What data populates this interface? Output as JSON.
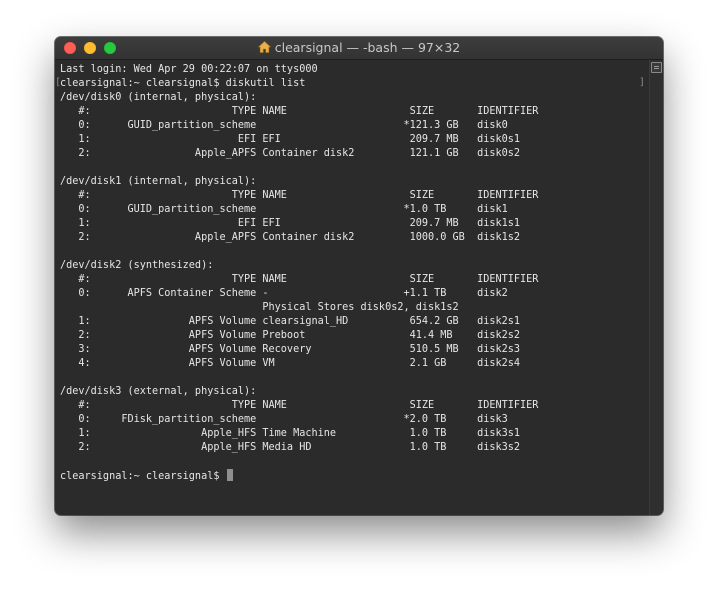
{
  "window": {
    "title": "clearsignal — -bash — 97×32"
  },
  "terminal": {
    "lines": [
      "Last login: Wed Apr 29 00:22:07 on ttys000",
      "clearsignal:~ clearsignal$ diskutil list",
      "/dev/disk0 (internal, physical):",
      "   #:                       TYPE NAME                    SIZE       IDENTIFIER",
      "   0:      GUID_partition_scheme                        *121.3 GB   disk0",
      "   1:                        EFI EFI                     209.7 MB   disk0s1",
      "   2:                 Apple_APFS Container disk2         121.1 GB   disk0s2",
      "",
      "/dev/disk1 (internal, physical):",
      "   #:                       TYPE NAME                    SIZE       IDENTIFIER",
      "   0:      GUID_partition_scheme                        *1.0 TB     disk1",
      "   1:                        EFI EFI                     209.7 MB   disk1s1",
      "   2:                 Apple_APFS Container disk2         1000.0 GB  disk1s2",
      "",
      "/dev/disk2 (synthesized):",
      "   #:                       TYPE NAME                    SIZE       IDENTIFIER",
      "   0:      APFS Container Scheme -                      +1.1 TB     disk2",
      "                                 Physical Stores disk0s2, disk1s2",
      "   1:                APFS Volume clearsignal_HD          654.2 GB   disk2s1",
      "   2:                APFS Volume Preboot                 41.4 MB    disk2s2",
      "   3:                APFS Volume Recovery                510.5 MB   disk2s3",
      "   4:                APFS Volume VM                      2.1 GB     disk2s4",
      "",
      "/dev/disk3 (external, physical):",
      "   #:                       TYPE NAME                    SIZE       IDENTIFIER",
      "   0:     FDisk_partition_scheme                        *2.0 TB     disk3",
      "   1:                  Apple_HFS Time Machine            1.0 TB     disk3s1",
      "   2:                  Apple_HFS Media HD                1.0 TB     disk3s2",
      ""
    ],
    "prompt": "clearsignal:~ clearsignal$ "
  }
}
